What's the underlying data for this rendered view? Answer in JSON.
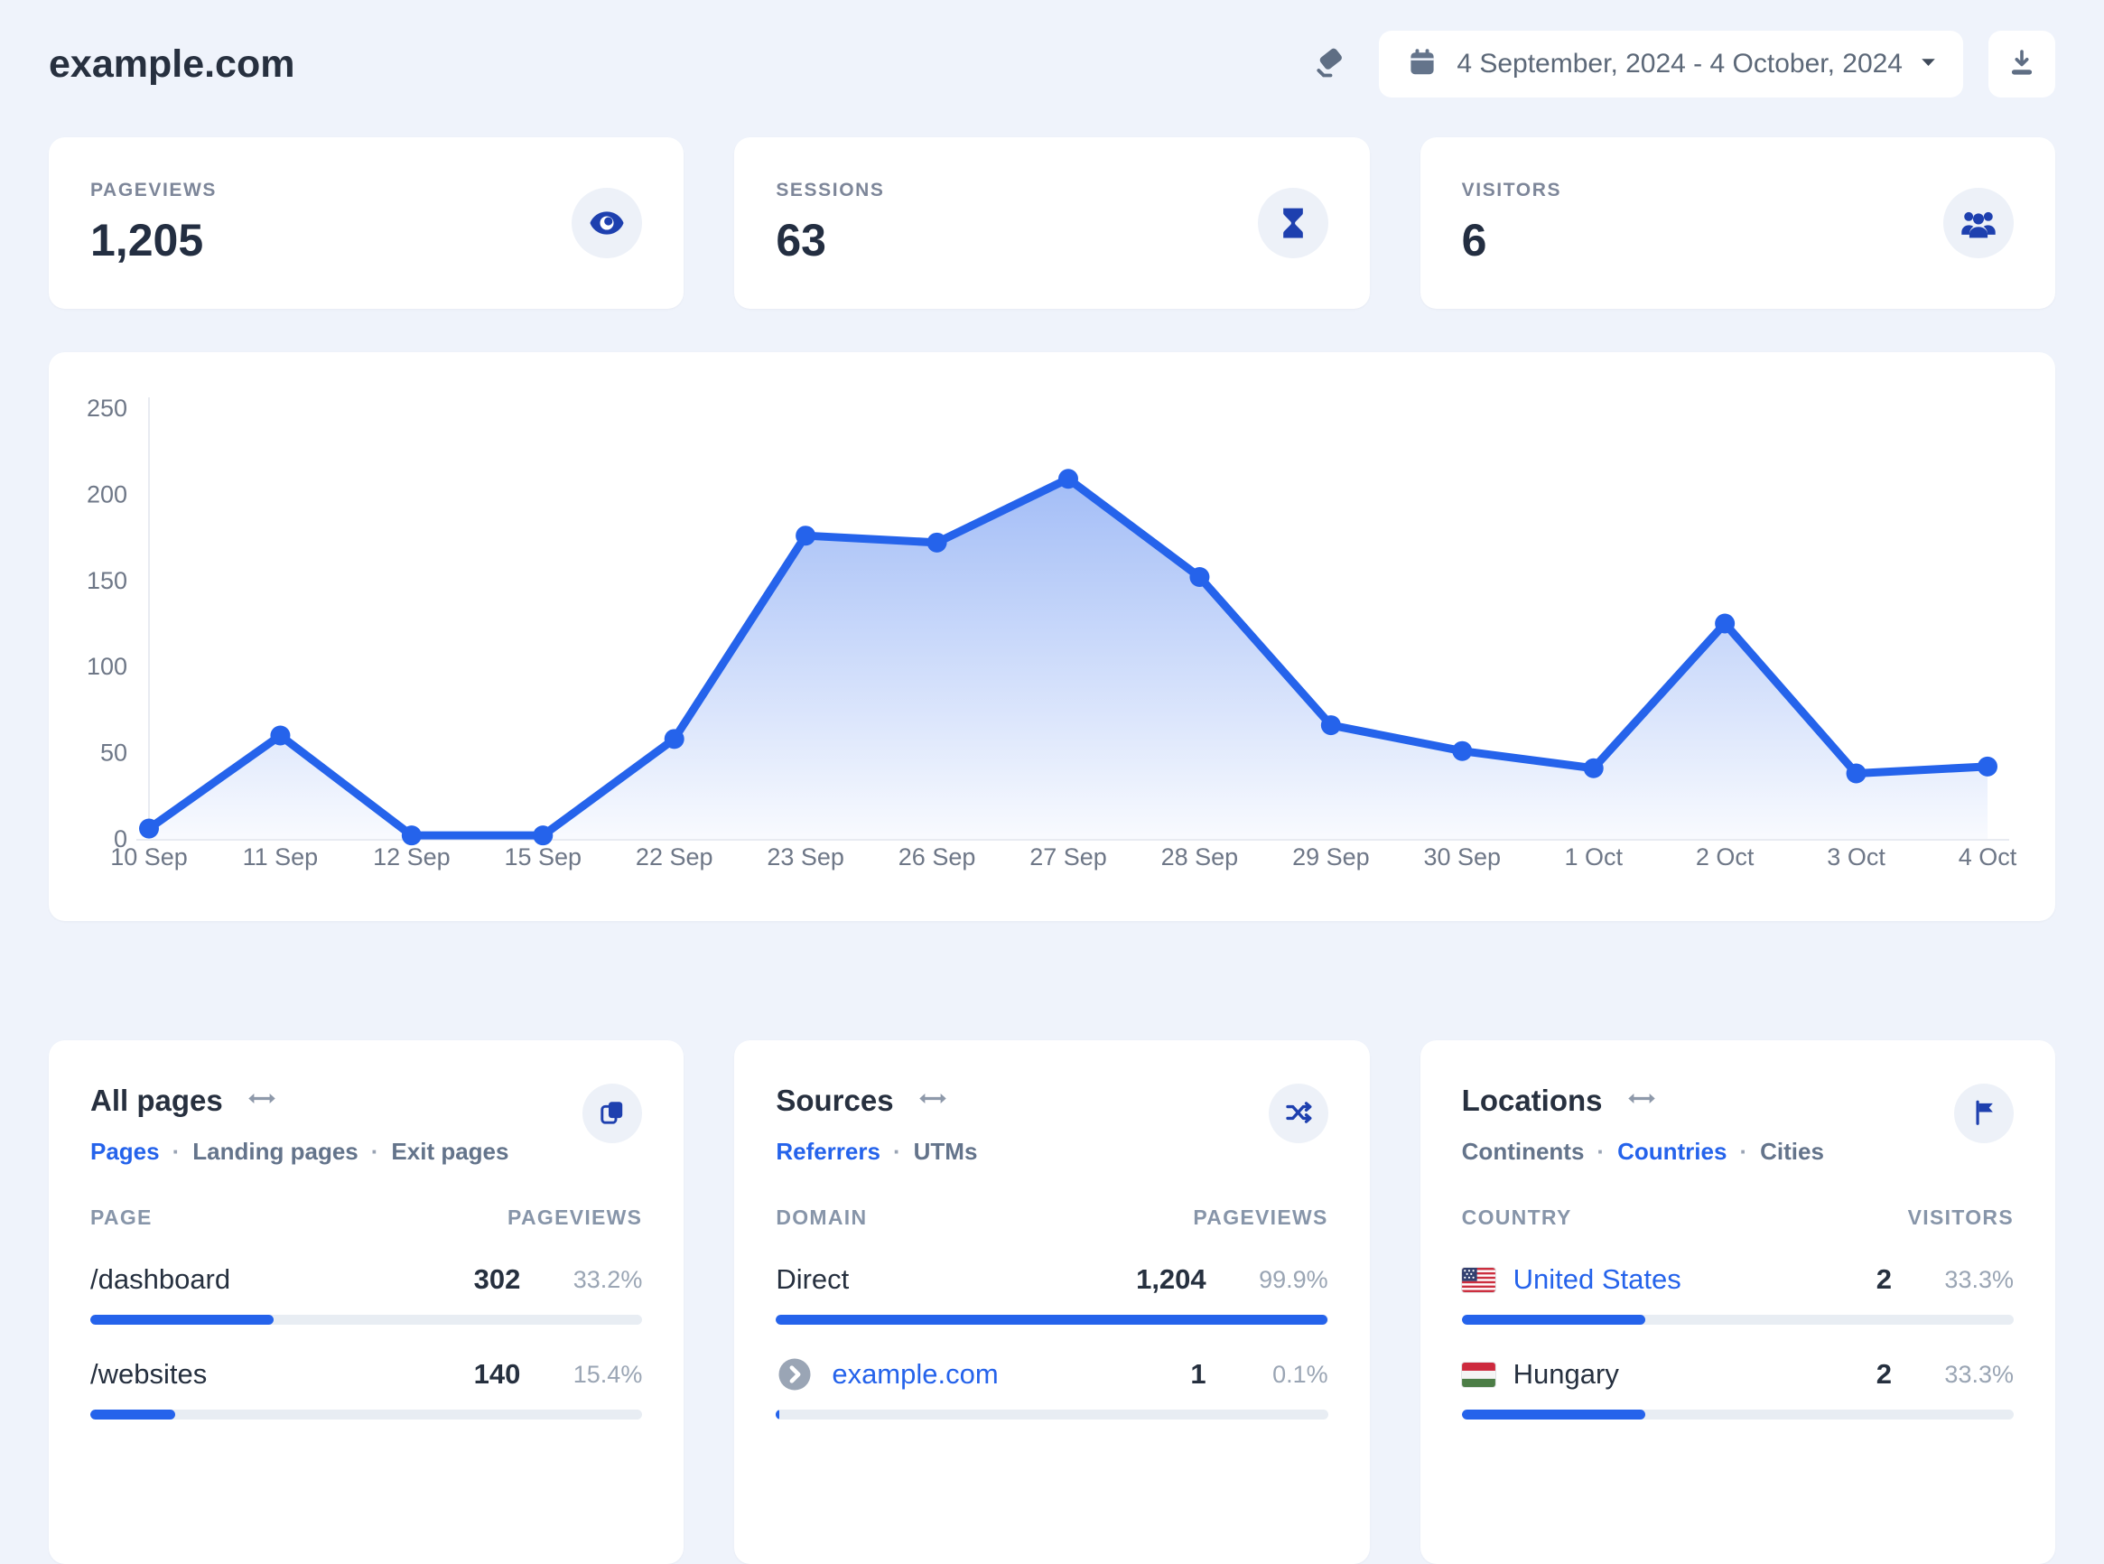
{
  "header": {
    "site_title": "example.com",
    "date_range": "4 September, 2024 - 4 October, 2024",
    "actions": {
      "clear_icon": "eraser-icon",
      "calendar_icon": "calendar-icon",
      "dropdown_icon": "caret-down-icon",
      "export_icon": "download-icon"
    }
  },
  "stats": [
    {
      "label": "PAGEVIEWS",
      "value": "1,205",
      "icon": "eye-icon"
    },
    {
      "label": "SESSIONS",
      "value": "63",
      "icon": "hourglass-icon"
    },
    {
      "label": "VISITORS",
      "value": "6",
      "icon": "people-icon"
    }
  ],
  "chart_data": {
    "type": "area",
    "x": [
      "10 Sep",
      "11 Sep",
      "12 Sep",
      "15 Sep",
      "22 Sep",
      "23 Sep",
      "26 Sep",
      "27 Sep",
      "28 Sep",
      "29 Sep",
      "30 Sep",
      "1 Oct",
      "2 Oct",
      "3 Oct",
      "4 Oct"
    ],
    "series": [
      {
        "name": "Pageviews",
        "values": [
          6,
          60,
          2,
          2,
          58,
          176,
          172,
          209,
          152,
          66,
          51,
          41,
          125,
          38,
          42
        ]
      }
    ],
    "ylim": [
      0,
      250
    ],
    "yticks": [
      0,
      50,
      100,
      150,
      200,
      250
    ],
    "grid": false,
    "legend": false,
    "line_color": "#2563eb",
    "fill": "vertical-gradient"
  },
  "panels": {
    "pages": {
      "title": "All pages",
      "icon": "copy-icon",
      "tabs": [
        {
          "label": "Pages",
          "active": true
        },
        {
          "label": "Landing pages",
          "active": false
        },
        {
          "label": "Exit pages",
          "active": false
        }
      ],
      "columns": [
        "PAGE",
        "PAGEVIEWS"
      ],
      "rows": [
        {
          "name": "/dashboard",
          "value": "302",
          "percent": "33.2%",
          "bar": 33.2
        },
        {
          "name": "/websites",
          "value": "140",
          "percent": "15.4%",
          "bar": 15.4
        }
      ]
    },
    "sources": {
      "title": "Sources",
      "icon": "shuffle-icon",
      "tabs": [
        {
          "label": "Referrers",
          "active": true
        },
        {
          "label": "UTMs",
          "active": false
        }
      ],
      "columns": [
        "DOMAIN",
        "PAGEVIEWS"
      ],
      "rows": [
        {
          "name": "Direct",
          "value": "1,204",
          "percent": "99.9%",
          "bar": 99.9
        },
        {
          "name": "example.com",
          "value": "1",
          "percent": "0.1%",
          "bar": 0.1,
          "icon": "chevron-right-icon"
        }
      ]
    },
    "locations": {
      "title": "Locations",
      "icon": "flag-icon",
      "tabs": [
        {
          "label": "Continents",
          "active": false
        },
        {
          "label": "Countries",
          "active": true
        },
        {
          "label": "Cities",
          "active": false
        }
      ],
      "columns": [
        "COUNTRY",
        "VISITORS"
      ],
      "rows": [
        {
          "name": "United States",
          "value": "2",
          "percent": "33.3%",
          "bar": 33.3,
          "flag": "us-flag-icon"
        },
        {
          "name": "Hungary",
          "value": "2",
          "percent": "33.3%",
          "bar": 33.3,
          "flag": "hungary-flag-icon"
        }
      ]
    }
  }
}
